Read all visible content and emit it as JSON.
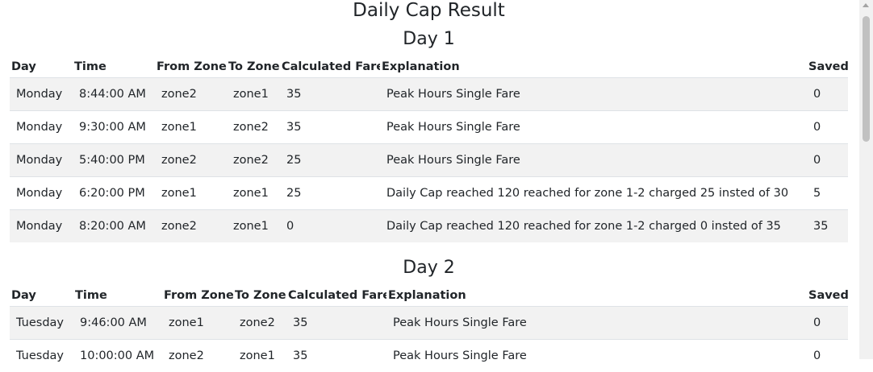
{
  "page": {
    "title": "Daily Cap Result"
  },
  "columns": [
    "Day",
    "Time",
    "From Zone",
    "To Zone",
    "Calculated Fare",
    "Explanation",
    "Saved"
  ],
  "days": [
    {
      "title": "Day 1",
      "rows": [
        [
          "Monday",
          "8:44:00 AM",
          "zone2",
          "zone1",
          "35",
          "Peak Hours Single Fare",
          "0"
        ],
        [
          "Monday",
          "9:30:00 AM",
          "zone1",
          "zone2",
          "35",
          "Peak Hours Single Fare",
          "0"
        ],
        [
          "Monday",
          "5:40:00 PM",
          "zone2",
          "zone2",
          "25",
          "Peak Hours Single Fare",
          "0"
        ],
        [
          "Monday",
          "6:20:00 PM",
          "zone1",
          "zone1",
          "25",
          "Daily Cap reached 120 reached for zone 1-2 charged 25 insted of 30",
          "5"
        ],
        [
          "Monday",
          "8:20:00 AM",
          "zone2",
          "zone1",
          "0",
          "Daily Cap reached 120 reached for zone 1-2 charged 0 insted of 35",
          "35"
        ]
      ]
    },
    {
      "title": "Day 2",
      "rows": [
        [
          "Tuesday",
          "9:46:00 AM",
          "zone1",
          "zone2",
          "35",
          "Peak Hours Single Fare",
          "0"
        ],
        [
          "Tuesday",
          "10:00:00 AM",
          "zone2",
          "zone1",
          "35",
          "Peak Hours Single Fare",
          "0"
        ]
      ]
    }
  ]
}
